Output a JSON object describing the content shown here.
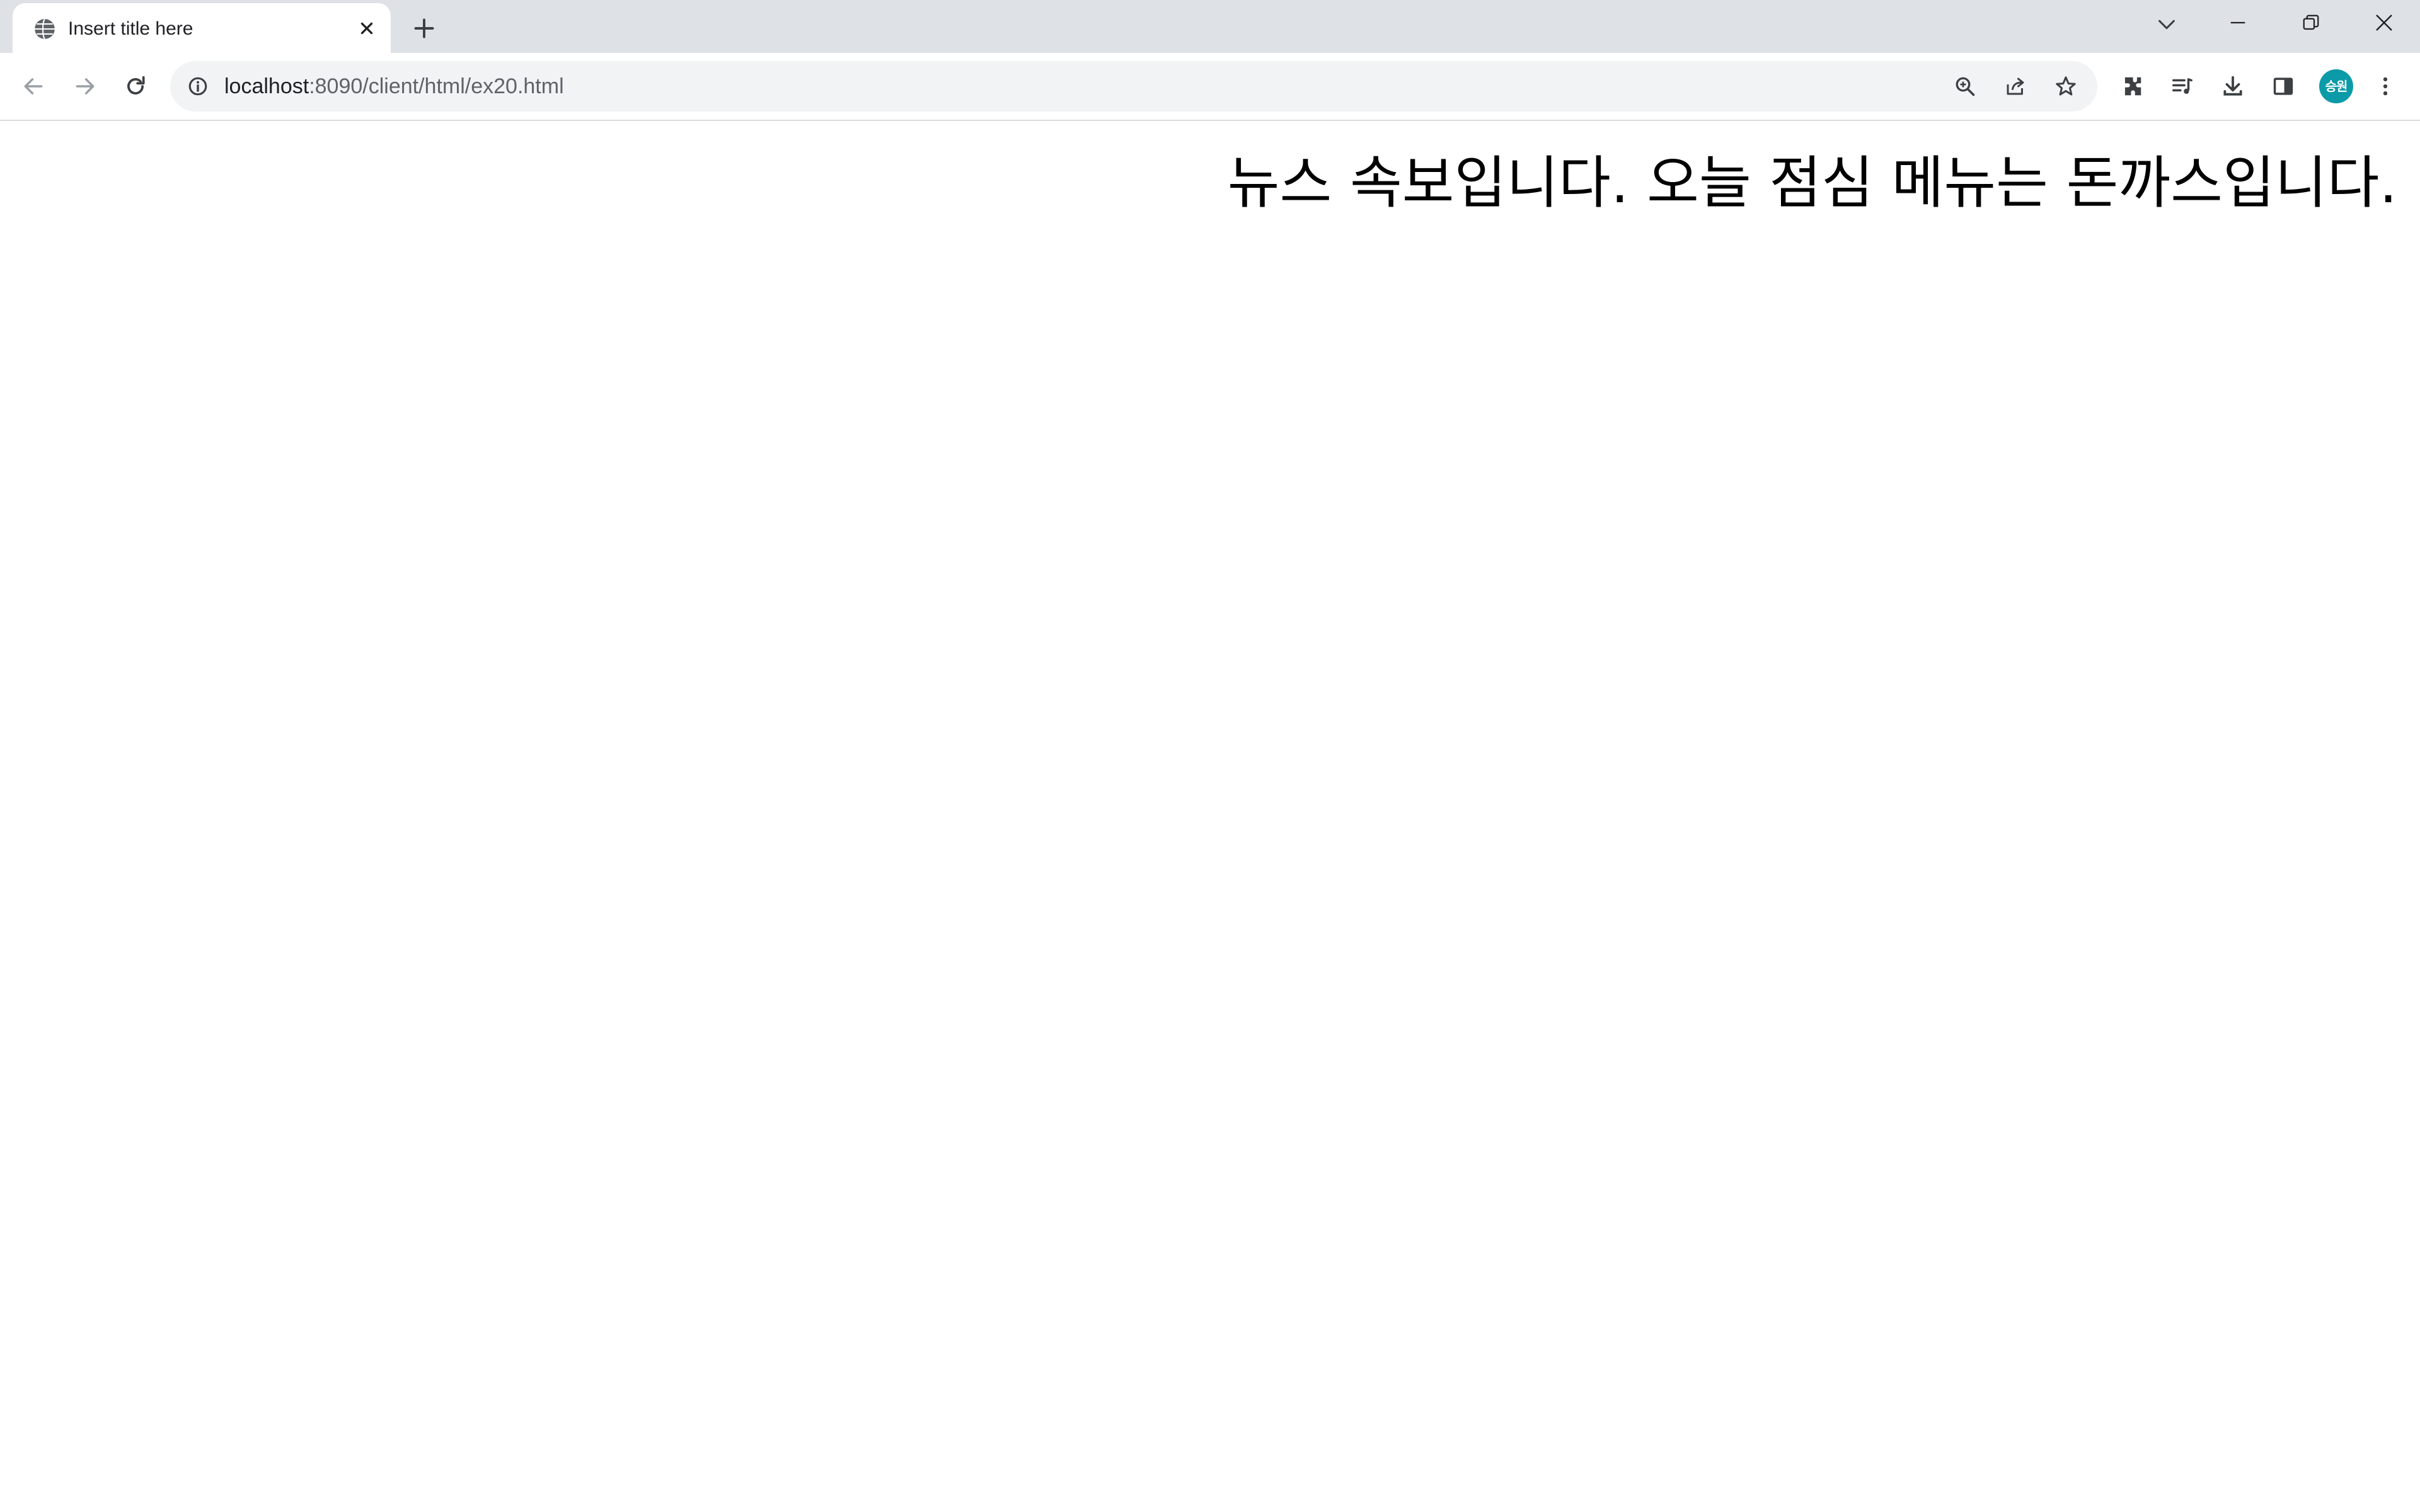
{
  "browser": {
    "tab": {
      "title": "Insert title here",
      "favicon": "globe-icon"
    },
    "address_bar": {
      "host": "localhost",
      "path": ":8090/client/html/ex20.html",
      "site_info_icon": "info-icon"
    },
    "toolbar_icons": [
      "back-icon",
      "forward-icon",
      "reload-icon",
      "zoom-icon",
      "share-icon",
      "star-icon",
      "extensions-icon",
      "media-icon",
      "download-icon",
      "side-panel-icon",
      "kebab-menu-icon"
    ],
    "profile": {
      "label": "승원",
      "color": "#0b9aa8"
    }
  },
  "page": {
    "headline": "뉴스 속보입니다. 오늘 점심 메뉴는 돈까스입니다."
  }
}
